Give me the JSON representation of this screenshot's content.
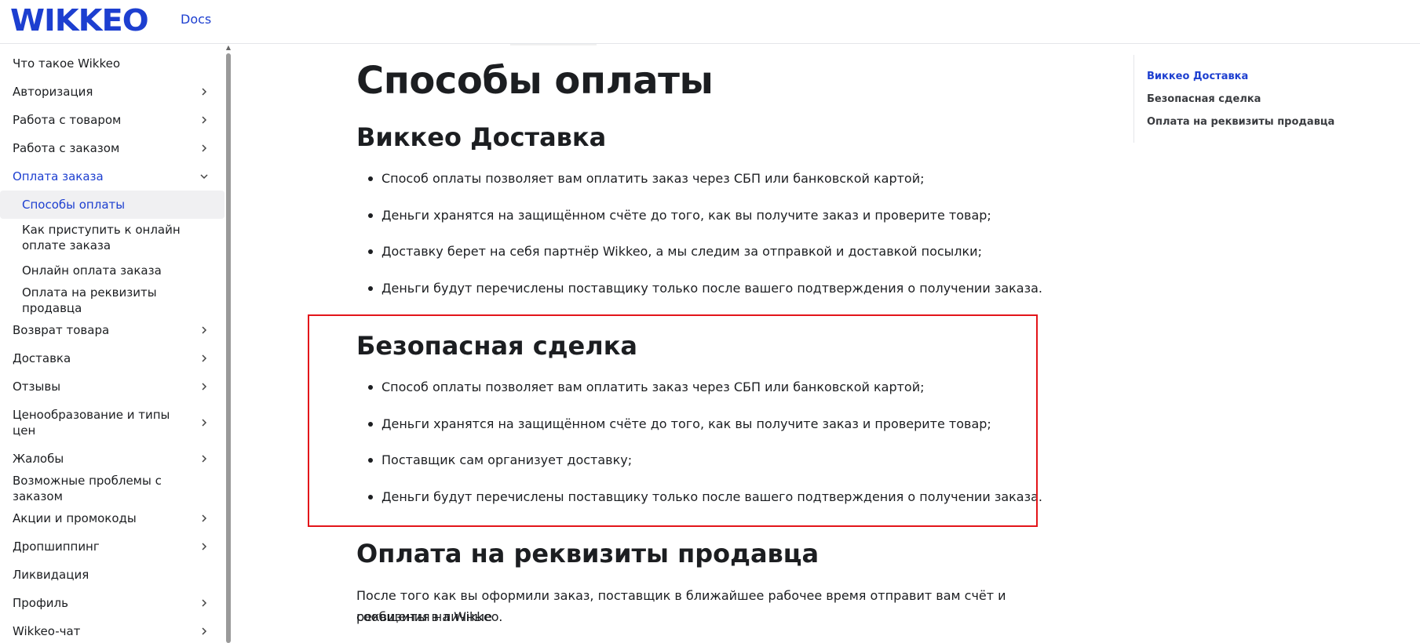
{
  "header": {
    "logo": "WIKKEO",
    "docs_link": "Docs"
  },
  "sidebar": {
    "items": [
      {
        "label": "Что такое Wikkeo",
        "chevron": "none"
      },
      {
        "label": "Авторизация",
        "chevron": "right"
      },
      {
        "label": "Работа с товаром",
        "chevron": "right"
      },
      {
        "label": "Работа с заказом",
        "chevron": "right"
      },
      {
        "label": "Оплата заказа",
        "chevron": "down"
      },
      {
        "label": "Способы оплаты",
        "chevron": "none"
      },
      {
        "label": "Как приступить к онлайн оплате заказа",
        "chevron": "none"
      },
      {
        "label": "Онлайн оплата заказа",
        "chevron": "none"
      },
      {
        "label": "Оплата на реквизиты продавца",
        "chevron": "none"
      },
      {
        "label": "Возврат товара",
        "chevron": "right"
      },
      {
        "label": "Доставка",
        "chevron": "right"
      },
      {
        "label": "Отзывы",
        "chevron": "right"
      },
      {
        "label": "Ценообразование и типы цен",
        "chevron": "right"
      },
      {
        "label": "Жалобы",
        "chevron": "right"
      },
      {
        "label": "Возможные проблемы с заказом",
        "chevron": "none"
      },
      {
        "label": "Акции и промокоды",
        "chevron": "right"
      },
      {
        "label": "Дропшиппинг",
        "chevron": "right"
      },
      {
        "label": "Ликвидация",
        "chevron": "none"
      },
      {
        "label": "Профиль",
        "chevron": "right"
      },
      {
        "label": "Wikkeo-чат",
        "chevron": "right"
      }
    ]
  },
  "main": {
    "title": "Способы оплаты",
    "sections": [
      {
        "heading": "Виккео Доставка",
        "bullets": [
          "Способ оплаты позволяет вам оплатить заказ через СБП или банковской картой;",
          "Деньги хранятся на защищённом счёте до того, как вы получите заказ и проверите товар;",
          "Доставку берет на себя партнёр Wikkeo, а мы следим за отправкой и доставкой посылки;",
          "Деньги будут перечислены поставщику только после вашего подтверждения о получении заказа."
        ]
      },
      {
        "heading": "Безопасная сделка",
        "bullets": [
          "Способ оплаты позволяет вам оплатить заказ через СБП или банковской картой;",
          "Деньги хранятся на защищённом счёте до того, как вы получите заказ и проверите товар;",
          "Поставщик сам организует доставку;",
          "Деньги будут перечислены поставщику только после вашего подтверждения о получении заказа."
        ]
      },
      {
        "heading": "Оплата на реквизиты продавца",
        "paragraph_line1": "После того как вы оформили заказ, поставщик в ближайшее рабочее время отправит вам счёт и реквизиты в личные",
        "paragraph_line2": "сообщения на Wikkeo."
      }
    ]
  },
  "toc": {
    "items": [
      "Виккео Доставка",
      "Безопасная сделка",
      "Оплата на реквизиты продавца"
    ]
  },
  "colors": {
    "accent": "#1d3fd0",
    "highlight_border": "#e3151a",
    "active_bg": "#f0f0f2"
  }
}
